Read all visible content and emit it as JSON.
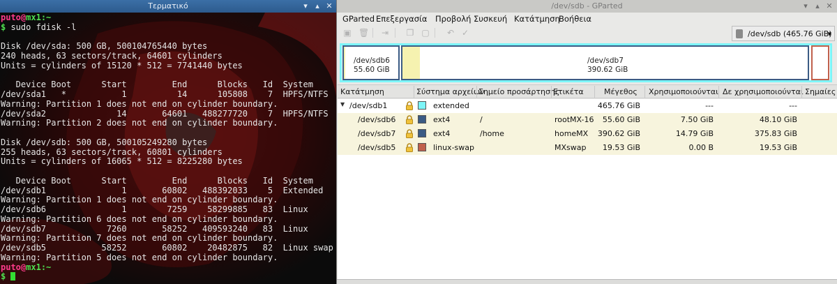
{
  "terminal": {
    "title": "Τερματικό",
    "user": "puto",
    "at": "@",
    "host": "mx1",
    "path": ":~",
    "prompt_symbol": "$",
    "command": " sudo fdisk -l",
    "output": [
      "",
      "Disk /dev/sda: 500 GB, 500104765440 bytes",
      "240 heads, 63 sectors/track, 64601 cylinders",
      "Units = cylinders of 15120 * 512 = 7741440 bytes",
      "",
      "   Device Boot      Start         End      Blocks   Id  System",
      "/dev/sda1   *           1          14      105808    7  HPFS/NTFS",
      "Warning: Partition 1 does not end on cylinder boundary.",
      "/dev/sda2              14       64601   488277720    7  HPFS/NTFS",
      "Warning: Partition 2 does not end on cylinder boundary.",
      "",
      "Disk /dev/sdb: 500 GB, 500105249280 bytes",
      "255 heads, 63 sectors/track, 60801 cylinders",
      "Units = cylinders of 16065 * 512 = 8225280 bytes",
      "",
      "   Device Boot      Start         End      Blocks   Id  System",
      "/dev/sdb1               1       60802   488392033    5  Extended",
      "Warning: Partition 1 does not end on cylinder boundary.",
      "/dev/sdb6               1        7259    58299885   83  Linux",
      "Warning: Partition 6 does not end on cylinder boundary.",
      "/dev/sdb7            7260       58252   409593240   83  Linux",
      "Warning: Partition 7 does not end on cylinder boundary.",
      "/dev/sdb5           58252       60802    20482875   82  Linux swap",
      "Warning: Partition 5 does not end on cylinder boundary."
    ]
  },
  "gparted": {
    "title": "/dev/sdb - GParted",
    "menu": [
      "GParted",
      "Επεξεργασία",
      "Προβολή",
      "Συσκευή",
      "Κατάτμηση",
      "Βοήθεια"
    ],
    "device_selector": "/dev/sdb   (465.76 GiB)",
    "graph": {
      "sdb6": {
        "name": "/dev/sdb6",
        "size": "55.60 GiB"
      },
      "sdb7": {
        "name": "/dev/sdb7",
        "size": "390.62 GiB"
      }
    },
    "columns": [
      "Κατάτμηση",
      "Σύστημα αρχείων",
      "Σημείο προσάρτησης",
      "Ετικέτα",
      "Μέγεθος",
      "Χρησιμοποιούνται",
      "Δε χρησιμοποιούνται",
      "Σημαίες"
    ],
    "rows": [
      {
        "partition": "/dev/sdb1",
        "fs": "extended",
        "mount": "",
        "label": "",
        "size": "465.76 GiB",
        "used": "---",
        "unused": "---",
        "flags": "",
        "color": "#7df5f8"
      },
      {
        "partition": "/dev/sdb6",
        "fs": "ext4",
        "mount": "/",
        "label": "rootMX-16",
        "size": "55.60 GiB",
        "used": "7.50 GiB",
        "unused": "48.10 GiB",
        "flags": "",
        "color": "#3b5b84"
      },
      {
        "partition": "/dev/sdb7",
        "fs": "ext4",
        "mount": "/home",
        "label": "homeMX",
        "size": "390.62 GiB",
        "used": "14.79 GiB",
        "unused": "375.83 GiB",
        "flags": "",
        "color": "#3b5b84"
      },
      {
        "partition": "/dev/sdb5",
        "fs": "linux-swap",
        "mount": "",
        "label": "MXswap",
        "size": "19.53 GiB",
        "used": "0.00 B",
        "unused": "19.53 GiB",
        "flags": "",
        "color": "#c0604c"
      }
    ]
  }
}
